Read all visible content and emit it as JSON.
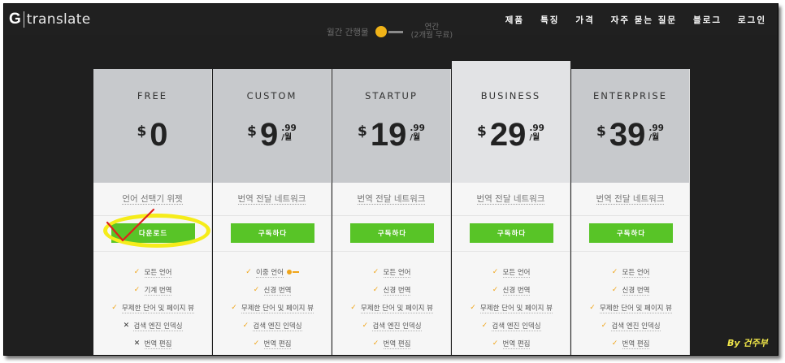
{
  "header": {
    "logo_letter": "G",
    "logo_word": "translate",
    "hero_ghost": "",
    "toggle_left": "월간 간행물",
    "toggle_right_line1": "연간",
    "toggle_right_line2": "(2개월 무료)",
    "nav": [
      "제품",
      "특징",
      "가격",
      "자주 묻는 질문",
      "블로그",
      "로그인"
    ]
  },
  "plans": [
    {
      "name": "FREE",
      "currency": "$",
      "amount": "0",
      "cents": "",
      "period": "",
      "subtitle": "언어 선택기 위젯",
      "button": "다운로드",
      "features": [
        {
          "icon": "check-icon",
          "text": "모든 언어"
        },
        {
          "icon": "check-icon",
          "text": "기계 번역"
        },
        {
          "icon": "check-icon",
          "text": "무제한 단어 및 페이지 뷰"
        },
        {
          "icon": "cross-icon",
          "text": "검색 엔진 인덱싱"
        },
        {
          "icon": "cross-icon",
          "text": "번역 편집"
        }
      ]
    },
    {
      "name": "CUSTOM",
      "currency": "$",
      "amount": "9",
      "cents": ".99",
      "period": "/월",
      "subtitle": "번역 전달 네트워크",
      "button": "구독하다",
      "features": [
        {
          "icon": "check-icon",
          "text": "이중 언어",
          "toggle": true
        },
        {
          "icon": "check-icon",
          "text": "신경 번역"
        },
        {
          "icon": "check-icon",
          "text": "무제한 단어 및 페이지 뷰"
        },
        {
          "icon": "check-icon",
          "text": "검색 엔진 인덱싱"
        },
        {
          "icon": "check-icon",
          "text": "번역 편집"
        }
      ]
    },
    {
      "name": "STARTUP",
      "currency": "$",
      "amount": "19",
      "cents": ".99",
      "period": "/월",
      "subtitle": "번역 전달 네트워크",
      "button": "구독하다",
      "features": [
        {
          "icon": "check-icon",
          "text": "모든 언어"
        },
        {
          "icon": "check-icon",
          "text": "신경 번역"
        },
        {
          "icon": "check-icon",
          "text": "무제한 단어 및 페이지 뷰"
        },
        {
          "icon": "check-icon",
          "text": "검색 엔진 인덱싱"
        },
        {
          "icon": "check-icon",
          "text": "번역 편집"
        }
      ]
    },
    {
      "name": "BUSINESS",
      "currency": "$",
      "amount": "29",
      "cents": ".99",
      "period": "/월",
      "subtitle": "번역 전달 네트워크",
      "button": "구독하다",
      "featured": true,
      "features": [
        {
          "icon": "check-icon",
          "text": "모든 언어"
        },
        {
          "icon": "check-icon",
          "text": "신경 번역"
        },
        {
          "icon": "check-icon",
          "text": "무제한 단어 및 페이지 뷰"
        },
        {
          "icon": "check-icon",
          "text": "검색 엔진 인덱싱"
        },
        {
          "icon": "check-icon",
          "text": "번역 편집"
        }
      ]
    },
    {
      "name": "ENTERPRISE",
      "currency": "$",
      "amount": "39",
      "cents": ".99",
      "period": "/월",
      "subtitle": "번역 전달 네트워크",
      "button": "구독하다",
      "features": [
        {
          "icon": "check-icon",
          "text": "모든 언어"
        },
        {
          "icon": "check-icon",
          "text": "신경 번역"
        },
        {
          "icon": "check-icon",
          "text": "무제한 단어 및 페이지 뷰"
        },
        {
          "icon": "check-icon",
          "text": "검색 엔진 인덱싱"
        },
        {
          "icon": "check-icon",
          "text": "번역 편집"
        }
      ]
    }
  ],
  "signature": "By 건주부",
  "colors": {
    "accent_green": "#58c427",
    "check_orange": "#f0a51a",
    "annotation_yellow": "#f5ec1a",
    "annotation_red": "#e0201c",
    "topbar": "#202020"
  }
}
